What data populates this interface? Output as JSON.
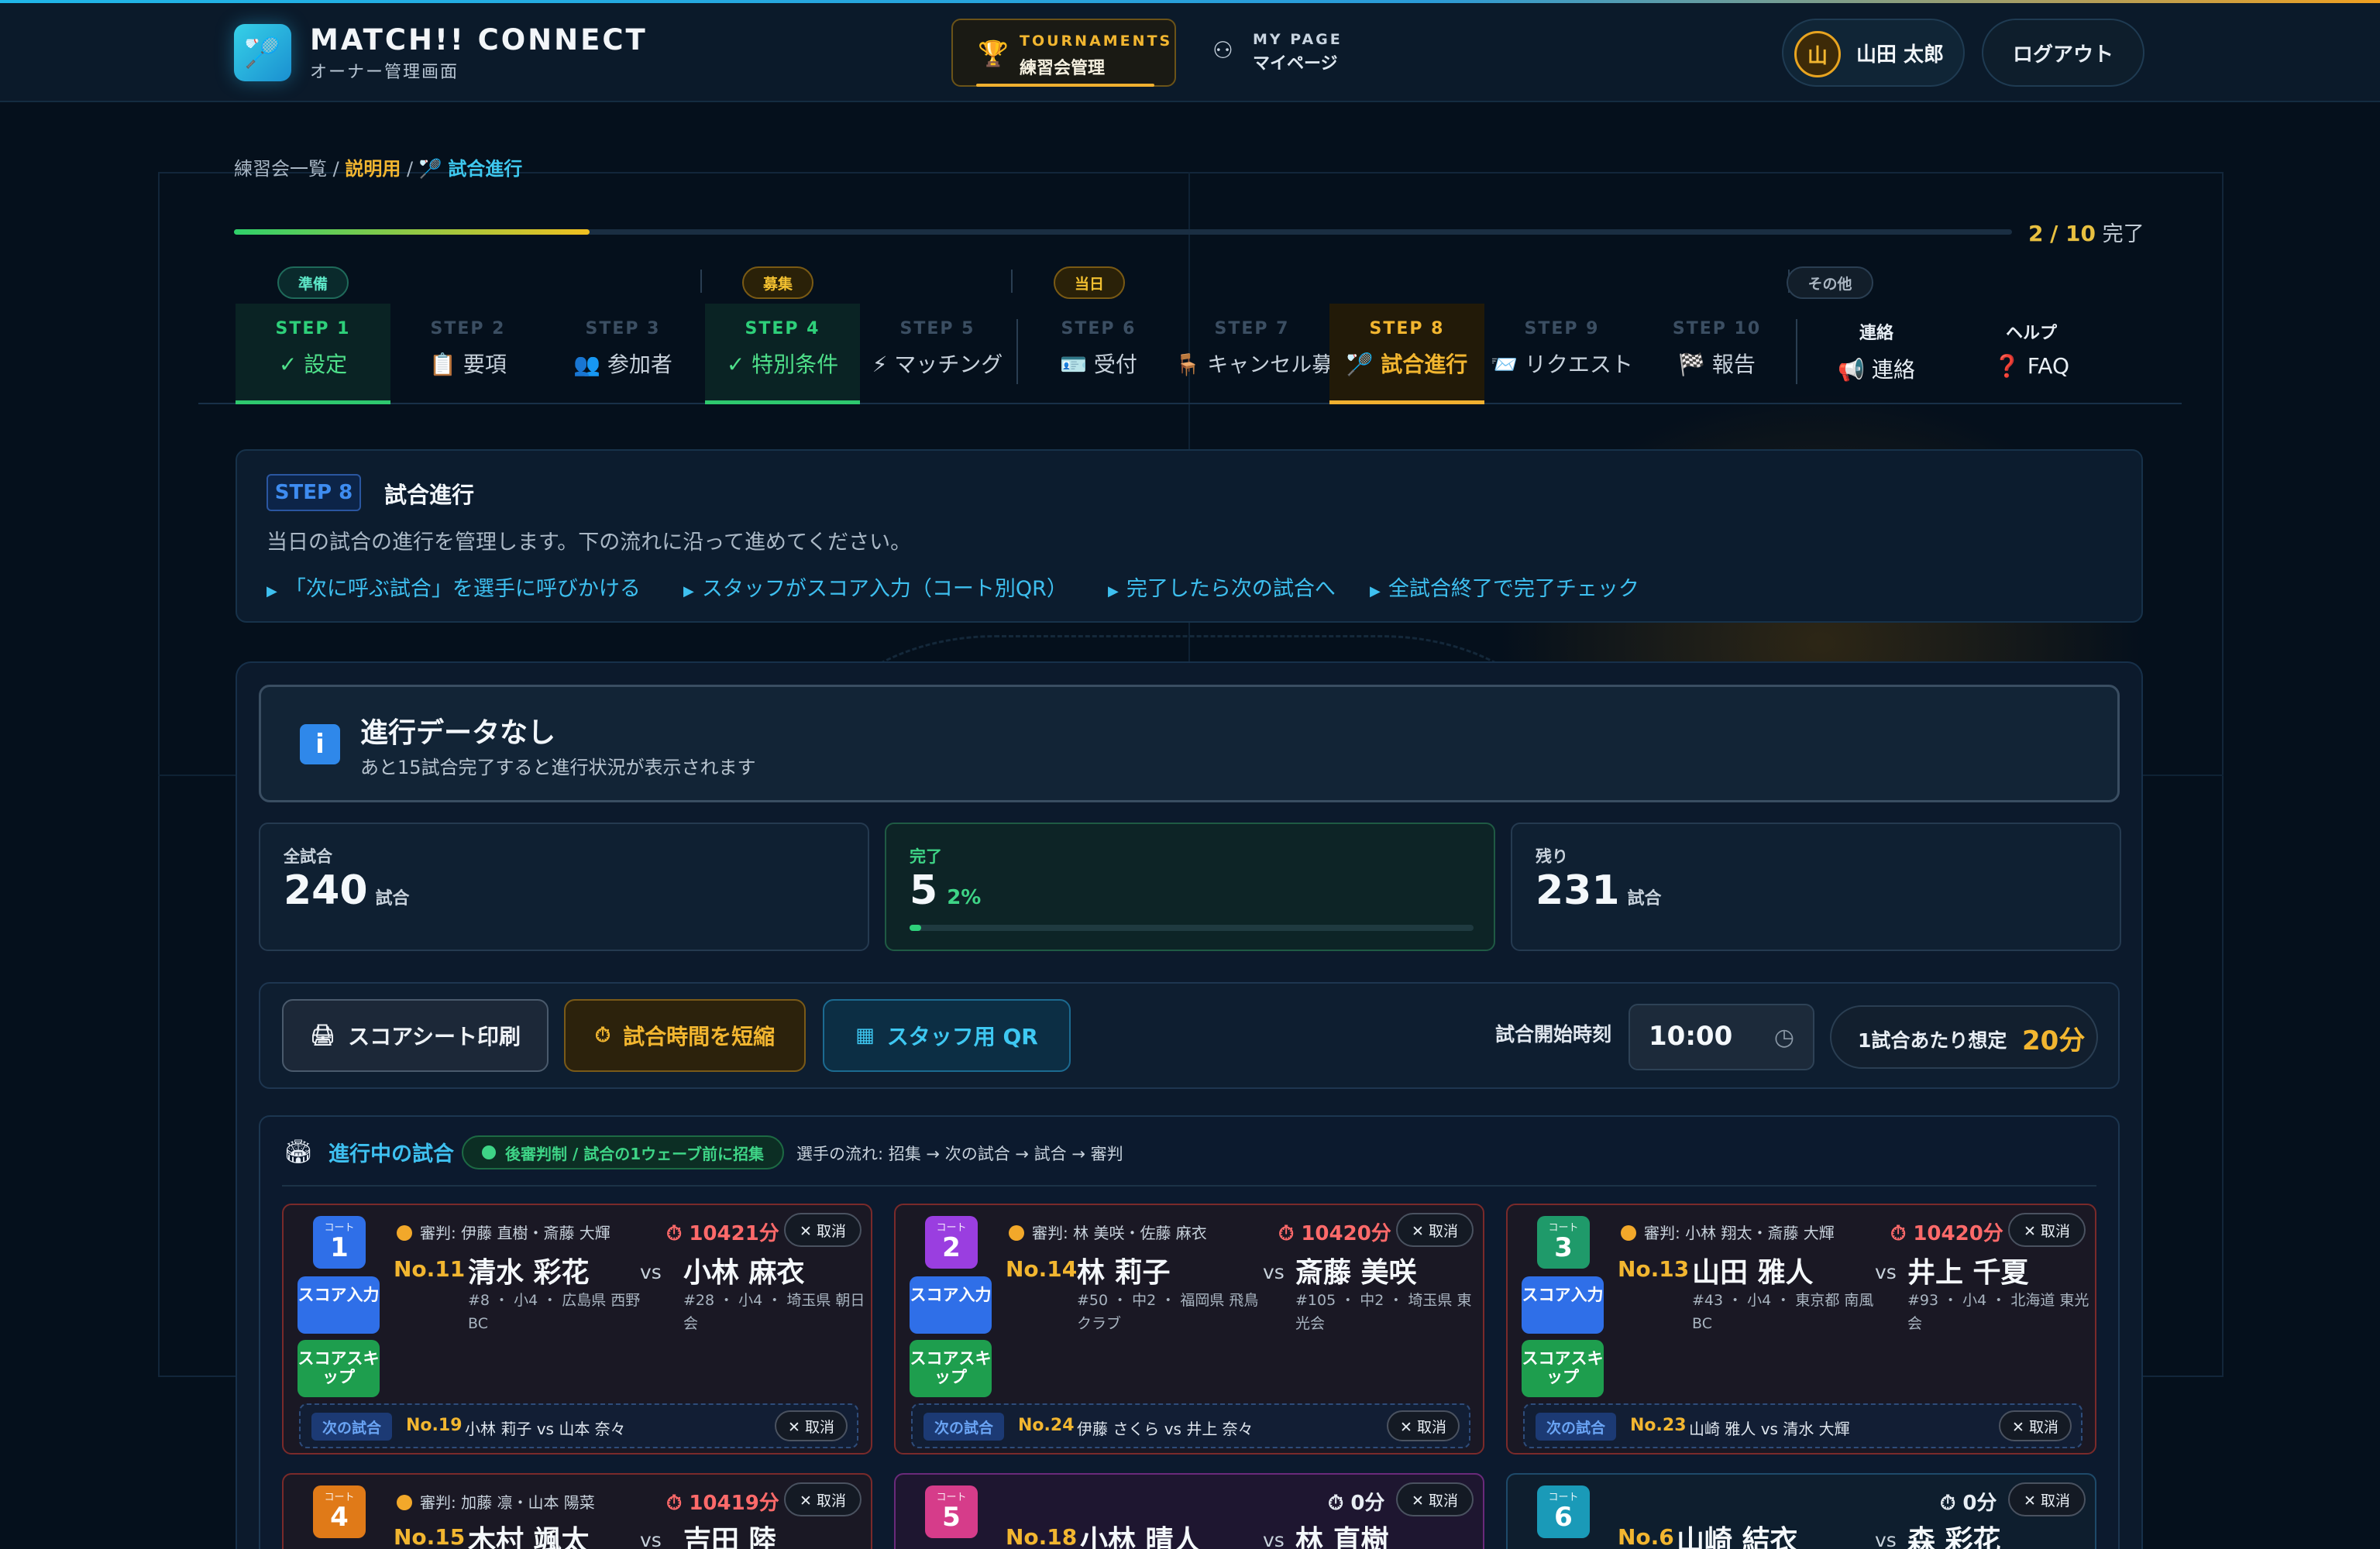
{
  "header": {
    "brand": "MATCH!! CONNECT",
    "brand_sub": "オーナー管理画面",
    "nav_tournaments_en": "TOURNAMENTS",
    "nav_tournaments_jp": "練習会管理",
    "nav_mypage_en": "MY PAGE",
    "nav_mypage_jp": "マイページ",
    "user_initial": "山",
    "user_name": "山田 太郎",
    "logout": "ログアウト"
  },
  "breadcrumb": {
    "root": "練習会一覧",
    "event": "説明用",
    "current": "試合進行",
    "sep": "/"
  },
  "progress": {
    "done": "2",
    "total": "/ 10",
    "suffix": "完了",
    "fraction": 0.2
  },
  "step_groups": [
    "準備",
    "募集",
    "当日",
    "その他"
  ],
  "steps": [
    {
      "num": "STEP 1",
      "label": "✓ 設定",
      "state": "done"
    },
    {
      "num": "STEP 2",
      "label": "📋 要項",
      "state": "todo"
    },
    {
      "num": "STEP 3",
      "label": "👥 参加者",
      "state": "todo"
    },
    {
      "num": "STEP 4",
      "label": "✓ 特別条件",
      "state": "done"
    },
    {
      "num": "STEP 5",
      "label": "⚡ マッチング",
      "state": "todo"
    },
    {
      "num": "STEP 6",
      "label": "🪪 受付",
      "state": "todo"
    },
    {
      "num": "STEP 7",
      "label": "🪑 キャンセル募集",
      "state": "todo"
    },
    {
      "num": "STEP 8",
      "label": "🏸 試合進行",
      "state": "current"
    },
    {
      "num": "STEP 9",
      "label": "📨 リクエスト",
      "state": "todo"
    },
    {
      "num": "STEP 10",
      "label": "🏁 報告",
      "state": "todo"
    },
    {
      "num": "連絡",
      "label": "📢 連絡",
      "state": "other"
    },
    {
      "num": "ヘルプ",
      "label": "❓ FAQ",
      "state": "other"
    }
  ],
  "info": {
    "tag": "STEP 8",
    "title": "試合進行",
    "desc": "当日の試合の進行を管理します。下の流れに沿って進めてください。",
    "flow": [
      "「次に呼ぶ試合」を選手に呼びかける",
      "スタッフがスコア入力（コート別QR）",
      "完了したら次の試合へ",
      "全試合終了で完了チェック"
    ]
  },
  "nodata": {
    "icon": "i",
    "title": "進行データなし",
    "sub": "あと15試合完了すると進行状況が表示されます"
  },
  "stats": {
    "total_label": "全試合",
    "total_value": "240",
    "total_unit": "試合",
    "done_label": "完了",
    "done_value": "5",
    "done_pct": "2%",
    "done_fraction": 0.02,
    "remain_label": "残り",
    "remain_value": "231",
    "remain_unit": "試合"
  },
  "toolbar": {
    "print": "スコアシート印刷",
    "shorten": "試合時間を短縮",
    "qr": "スタッフ用 QR",
    "start_label": "試合開始時刻",
    "start_value": "10:00",
    "per_label": "1試合あたり想定",
    "per_value": "20分"
  },
  "ongoing": {
    "title": "進行中の試合",
    "pill": "後審判制 / 試合の1ウェーブ前に招集",
    "flow": "選手の流れ: 招集 → 次の試合 → 試合 → 審判",
    "court_label": "コート",
    "vs": "vs",
    "cancel": "✕ 取消",
    "score_input": "スコア入力",
    "score_skip": "スコアスキップ",
    "next_label": "次の試合",
    "cards": [
      {
        "court": "1",
        "ref": "審判: 伊藤 直樹・斎藤 大輝",
        "time": "⏱ 10421分",
        "no": "No.11",
        "p1": "清水 彩花",
        "p1_meta": "#8 ・ 小4 ・ 広島県 西野BC",
        "p2": "小林 麻衣",
        "p2_meta": "#28 ・ 小4 ・ 埼玉県 朝日会",
        "next_no": "No.19",
        "next_players": "小林 莉子 vs 山本 奈々"
      },
      {
        "court": "2",
        "ref": "審判: 林 美咲・佐藤 麻衣",
        "time": "⏱ 10420分",
        "no": "No.14",
        "p1": "林 莉子",
        "p1_meta": "#50 ・ 中2 ・ 福岡県 飛鳥クラブ",
        "p2": "斎藤 美咲",
        "p2_meta": "#105 ・ 中2 ・ 埼玉県 東光会",
        "next_no": "No.24",
        "next_players": "伊藤 さくら vs 井上 奈々"
      },
      {
        "court": "3",
        "ref": "審判: 小林 翔太・斎藤 大輝",
        "time": "⏱ 10420分",
        "no": "No.13",
        "p1": "山田 雅人",
        "p1_meta": "#43 ・ 小4 ・ 東京都 南風BC",
        "p2": "井上 千夏",
        "p2_meta": "#93 ・ 小4 ・ 北海道 東光会",
        "next_no": "No.23",
        "next_players": "山崎 雅人 vs 清水 大輝"
      },
      {
        "court": "4",
        "ref": "審判: 加藤 凛・山本 陽菜",
        "time": "⏱ 10419分",
        "no": "No.15",
        "p1": "木村 颯太",
        "p2": "吉田 陸"
      },
      {
        "court": "5",
        "ref": "",
        "time": "⏱ 0分",
        "no": "No.18",
        "p1": "小林 晴人",
        "p2": "林 直樹"
      },
      {
        "court": "6",
        "ref": "",
        "time": "⏱ 0分",
        "no": "No.6",
        "p1": "山崎 結衣",
        "p2": "森 彩花"
      }
    ]
  },
  "colors": {
    "accent": "#f2b630",
    "cyan": "#3ec8ee",
    "green": "#2ed07a",
    "danger": "#ff6a6a",
    "bg": "#05101c"
  }
}
